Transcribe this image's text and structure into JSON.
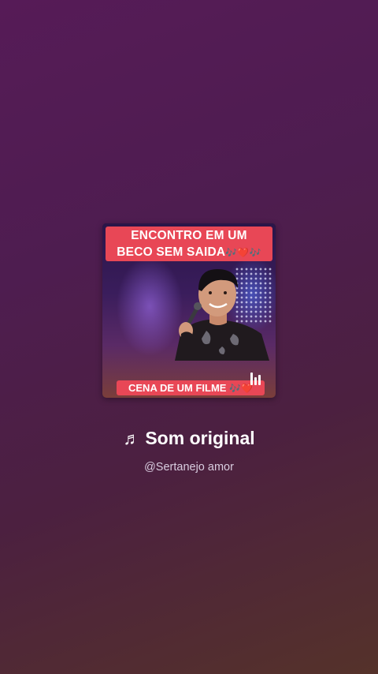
{
  "sound": {
    "cover": {
      "banner_line1": "ENCONTRO EM UM",
      "banner_line2": "BECO SEM SAIDA",
      "banner_line2_emoji": "🎶❤️🎶",
      "bottom_caption": "CENA DE UM FILME",
      "bottom_caption_emoji": "🎶❤️",
      "playing_icon": "audio-bars-icon"
    },
    "note_icon": "♬",
    "title": "Som original",
    "author": "@Sertanejo amor"
  },
  "colors": {
    "banner": "#e84756",
    "background_top": "#561b57",
    "background_bottom": "#55322a",
    "text": "#ffffff",
    "subtext": "#d9cde0"
  }
}
